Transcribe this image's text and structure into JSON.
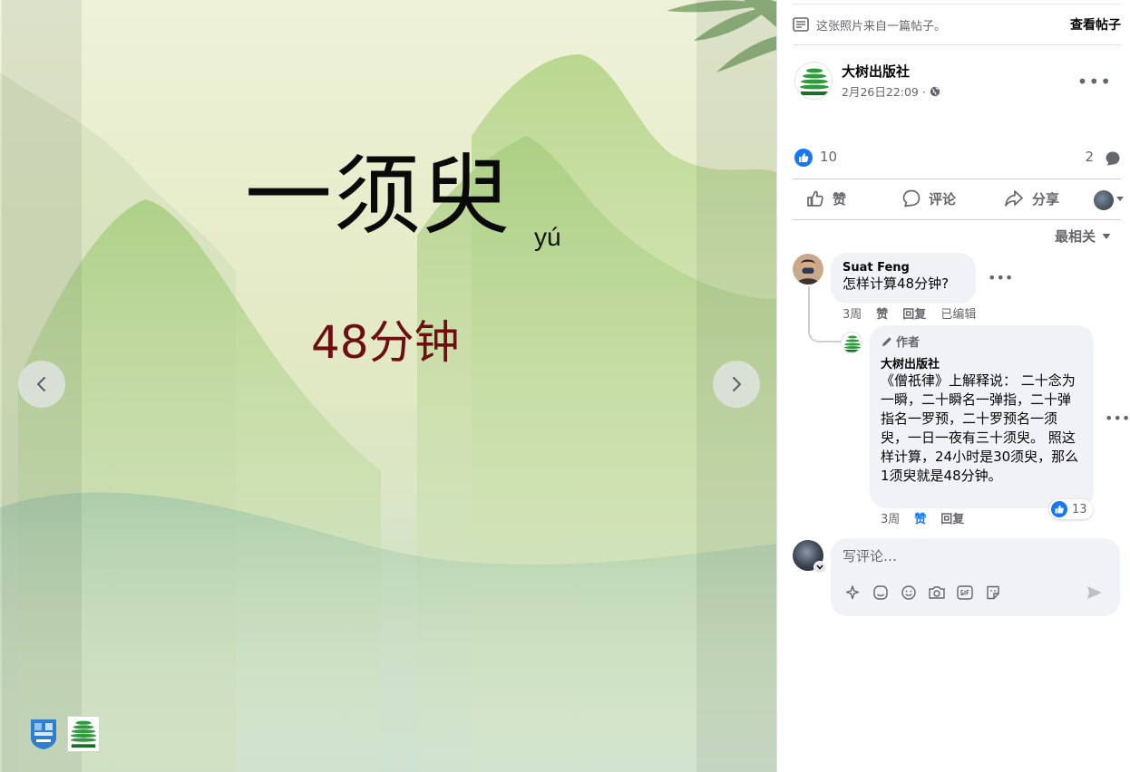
{
  "viewer": {
    "title": "一须臾",
    "pinyin": "yú",
    "subtitle": "48分钟",
    "prev_icon": "chevron-left-icon",
    "next_icon": "chevron-right-icon"
  },
  "panel": {
    "source_note": "这张照片来自一篇帖子。",
    "view_post": "查看帖子",
    "author": "大树出版社",
    "time": "2月26日22:09 ·",
    "like_count": "10",
    "comment_count": "2",
    "actions": {
      "like": "赞",
      "comment": "评论",
      "share": "分享"
    },
    "sort_label": "最相关"
  },
  "comments": [
    {
      "name": "Suat Feng",
      "text": "怎样计算48分钟?",
      "time": "3周",
      "like_label": "赞",
      "reply_label": "回复",
      "edited_label": "已编辑"
    },
    {
      "badge": "作者",
      "name": "大树出版社",
      "text": "《僧祇律》上解释说： 二十念为一瞬，二十瞬名一弹指，二十弹指名一罗预，二十罗预名一须臾，一日一夜有三十须臾。 照这样计算，24小时是30须臾，那么1须臾就是48分钟。",
      "reaction_count": "13",
      "time": "3周",
      "like_label": "赞",
      "reply_label": "回复"
    }
  ],
  "composer": {
    "placeholder": "写评论…"
  },
  "colors": {
    "accent": "#1877f2",
    "subtitle_red": "#6d0f12",
    "secondary_text": "#65676b",
    "bubble": "#f0f2f5"
  }
}
